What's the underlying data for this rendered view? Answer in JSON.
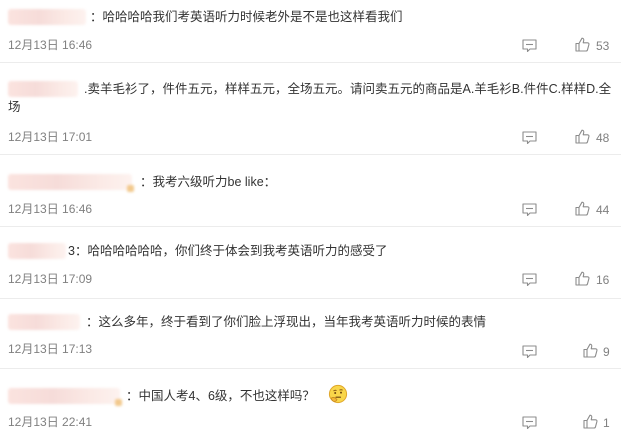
{
  "comments": [
    {
      "separator": "：",
      "text": "哈哈哈哈我们考英语听力时候老外是不是也这样看我们",
      "timestamp": "12月13日 16:46",
      "likes": "53"
    },
    {
      "separator": ".",
      "text": "卖羊毛衫了，件件五元，样样五元，全场五元。请问卖五元的商品是A.羊毛衫B.件件C.样样D.全场",
      "timestamp": "12月13日 17:01",
      "likes": "48"
    },
    {
      "separator": "：",
      "text": "我考六级听力be like：",
      "timestamp": "12月13日 16:46",
      "likes": "44"
    },
    {
      "separator": "3：",
      "text": "哈哈哈哈哈哈，你们终于体会到我考英语听力的感受了",
      "timestamp": "12月13日 17:09",
      "likes": "16"
    },
    {
      "separator": "：",
      "text": "这么多年，终于看到了你们脸上浮现出，当年我考英语听力时候的表情",
      "timestamp": "12月13日 17:13",
      "likes": "9"
    },
    {
      "separator": "：",
      "text": "中国人考4、6级，不也这样吗？",
      "timestamp": "12月13日 22:41",
      "likes": "1",
      "emoji": "thinking-face-emoji"
    }
  ],
  "icons": {
    "reply": "comment-bubble-icon",
    "like": "thumbs-up-icon"
  },
  "colors": {
    "text": "#333333",
    "meta": "#808080",
    "icon": "#8c8c8c",
    "blurred_name": "#f6dcd9"
  }
}
